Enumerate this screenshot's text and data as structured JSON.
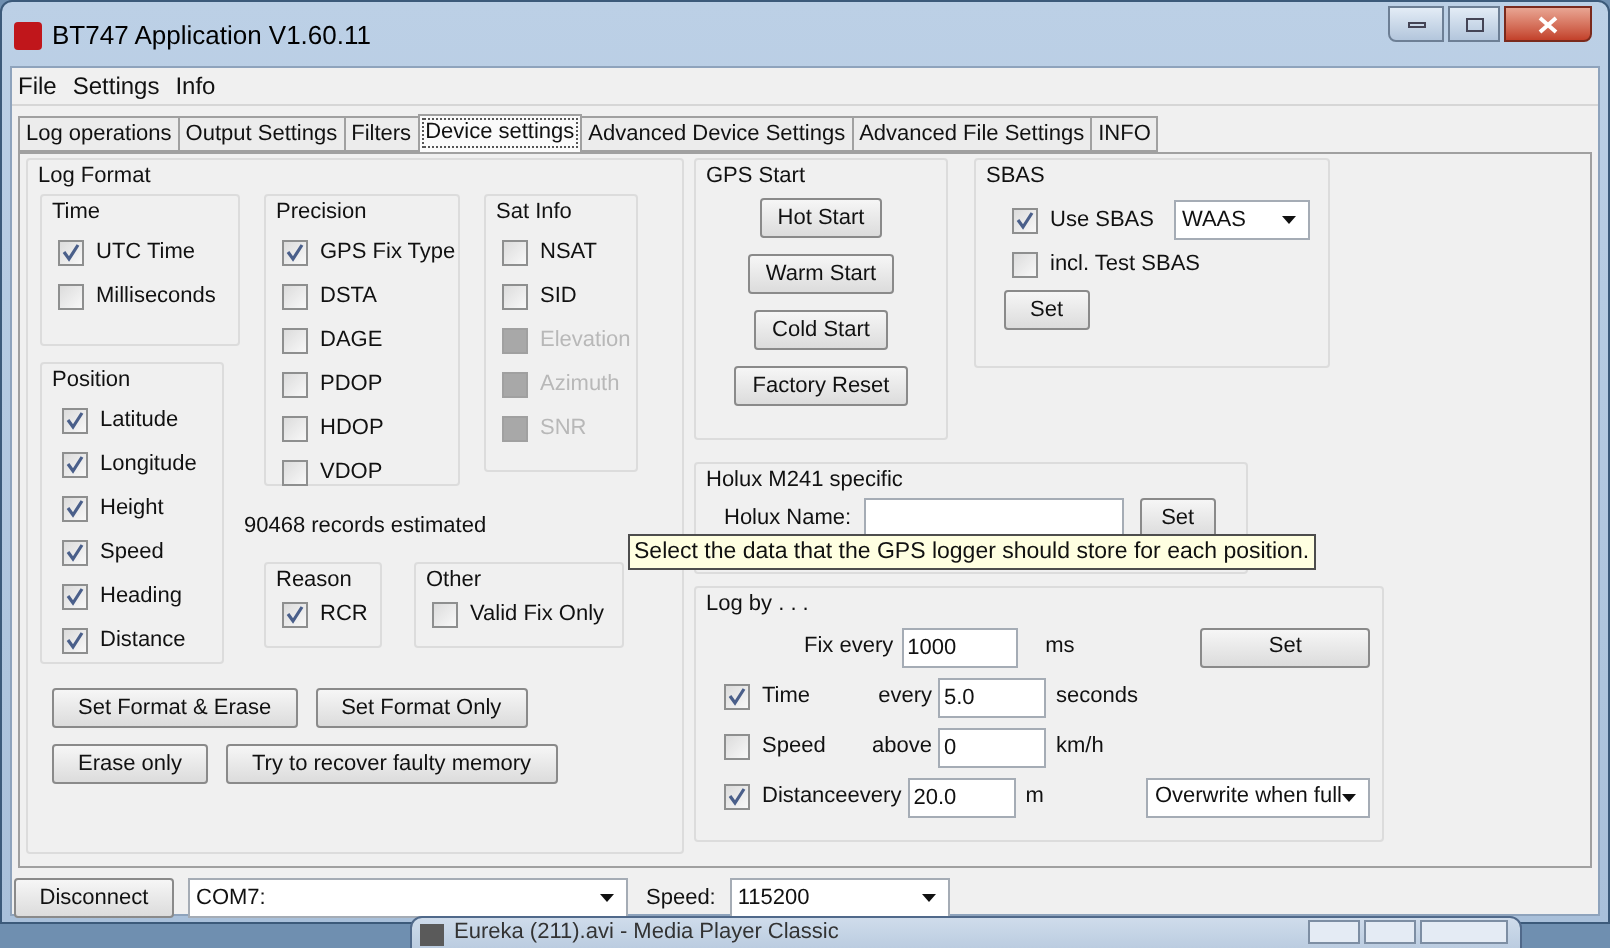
{
  "window": {
    "title": "BT747 Application V1.60.11"
  },
  "menu": [
    "File",
    "Settings",
    "Info"
  ],
  "tabs": [
    {
      "label": "Log operations",
      "selected": false
    },
    {
      "label": "Output Settings",
      "selected": false
    },
    {
      "label": "Filters",
      "selected": false
    },
    {
      "label": "Device settings",
      "selected": true
    },
    {
      "label": "Advanced Device Settings",
      "selected": false
    },
    {
      "label": "Advanced File Settings",
      "selected": false
    },
    {
      "label": "INFO",
      "selected": false
    }
  ],
  "log_format": {
    "title": "Log Format",
    "time": {
      "title": "Time",
      "options": [
        {
          "label": "UTC Time",
          "checked": true
        },
        {
          "label": "Milliseconds",
          "checked": false
        }
      ]
    },
    "position": {
      "title": "Position",
      "options": [
        {
          "label": "Latitude",
          "checked": true
        },
        {
          "label": "Longitude",
          "checked": true
        },
        {
          "label": "Height",
          "checked": true
        },
        {
          "label": "Speed",
          "checked": true
        },
        {
          "label": "Heading",
          "checked": true
        },
        {
          "label": "Distance",
          "checked": true
        }
      ]
    },
    "precision": {
      "title": "Precision",
      "options": [
        {
          "label": "GPS Fix Type",
          "checked": true
        },
        {
          "label": "DSTA",
          "checked": false
        },
        {
          "label": "DAGE",
          "checked": false
        },
        {
          "label": "PDOP",
          "checked": false
        },
        {
          "label": "HDOP",
          "checked": false
        },
        {
          "label": "VDOP",
          "checked": false
        }
      ]
    },
    "sat_info": {
      "title": "Sat Info",
      "options": [
        {
          "label": "NSAT",
          "checked": false,
          "disabled": false
        },
        {
          "label": "SID",
          "checked": false,
          "disabled": false
        },
        {
          "label": "Elevation",
          "checked": false,
          "disabled": true
        },
        {
          "label": "Azimuth",
          "checked": false,
          "disabled": true
        },
        {
          "label": "SNR",
          "checked": false,
          "disabled": true
        }
      ]
    },
    "records_estimate": "90468 records estimated",
    "reason": {
      "title": "Reason",
      "options": [
        {
          "label": "RCR",
          "checked": true
        }
      ]
    },
    "other": {
      "title": "Other",
      "options": [
        {
          "label": "Valid Fix Only",
          "checked": false
        }
      ]
    },
    "buttons": [
      [
        "Set Format & Erase",
        "Set Format Only"
      ],
      [
        "Erase only",
        "Try to recover faulty memory"
      ]
    ]
  },
  "gps_start": {
    "title": "GPS Start",
    "buttons": [
      "Hot Start",
      "Warm Start",
      "Cold Start",
      "Factory Reset"
    ]
  },
  "sbas": {
    "title": "SBAS",
    "use_sbas": {
      "label": "Use SBAS",
      "checked": true
    },
    "system": "WAAS",
    "test_sbas": {
      "label": "incl. Test SBAS",
      "checked": false
    },
    "button": "Set"
  },
  "holux": {
    "title": "Holux M241 specific",
    "name_label": "Holux Name:",
    "button": "Set"
  },
  "tooltip": "Select the data that the GPS logger should store for each position.",
  "log_by": {
    "title": "Log by . . .",
    "fix_label": "Fix every",
    "fix_value": "1000",
    "fix_unit": "ms",
    "button": "Set",
    "rows": [
      {
        "label": "Time",
        "checked": true,
        "qualifier": "every",
        "value": "5.0",
        "unit": "seconds"
      },
      {
        "label": "Speed",
        "checked": false,
        "qualifier": "above",
        "value": "0",
        "unit": "km/h"
      },
      {
        "label": "Distance",
        "checked": true,
        "qualifier": "every",
        "value": "20.0",
        "unit": "m"
      }
    ],
    "mode": "Overwrite when full"
  },
  "connection": {
    "button": "Disconnect",
    "port": "COM7:",
    "speed_label": "Speed:",
    "speed": "115200"
  },
  "background_window": {
    "title": "Eureka (211).avi - Media Player Classic"
  }
}
